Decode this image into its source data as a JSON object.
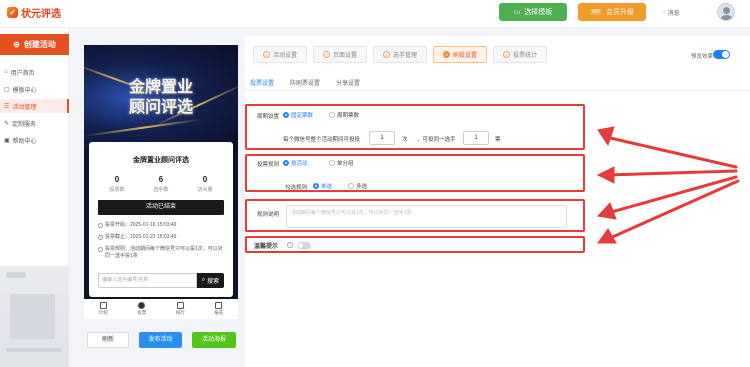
{
  "header": {
    "logo_text": "状元评选",
    "template_button": "选择模板",
    "vip_badge": "VIP",
    "vip_button": "会员升级",
    "message": "消息"
  },
  "sidebar": {
    "create_button": "创建活动",
    "items": [
      {
        "label": "用户首页",
        "icon": "home-icon"
      },
      {
        "label": "模板中心",
        "icon": "template-icon"
      },
      {
        "label": "活动管理",
        "icon": "list-icon",
        "active": true
      },
      {
        "label": "定制服务",
        "icon": "edit-icon"
      },
      {
        "label": "帮助中心",
        "icon": "help-icon"
      }
    ]
  },
  "preview": {
    "hero_line1": "金牌置业",
    "hero_line2": "顾问评选",
    "card_title": "金牌置业顾问评选",
    "stats": [
      {
        "value": "0",
        "label": "投票数"
      },
      {
        "value": "6",
        "label": "选手数"
      },
      {
        "value": "0",
        "label": "访问量"
      }
    ],
    "ended_label": "活动已结束",
    "info": [
      "投票开始：2025-01-16 15:03:49",
      "投票截止：2025-01-23 15:03:49",
      "投票规则：活动期间每个微信号只可以投1次，可以对同一选手投1票"
    ],
    "search_placeholder": "编输入选手编号/名称",
    "search_button": "搜索",
    "tabs": [
      {
        "label": "介绍",
        "icon": "intro-icon"
      },
      {
        "label": "投票",
        "icon": "vote-icon"
      },
      {
        "label": "排行",
        "icon": "rank-icon"
      },
      {
        "label": "报名",
        "icon": "signup-icon"
      }
    ],
    "refresh_button": "刷新",
    "publish_button": "发布活动",
    "poster_button": "活动海报"
  },
  "settings": {
    "steps": [
      {
        "num": "1",
        "label": "活动设置"
      },
      {
        "num": "2",
        "label": "页面设置"
      },
      {
        "num": "3",
        "label": "选手管理"
      },
      {
        "num": "4",
        "label": "刷投设置",
        "active": true
      },
      {
        "num": "5",
        "label": "投票统计"
      }
    ],
    "preview_switch_label": "预览效果",
    "subtabs": [
      "投票设置",
      "防刷票设置",
      "分享设置"
    ],
    "period_label": "周期设置",
    "period_options": [
      "固定票数",
      "周期票数"
    ],
    "votes_prefix": "每个微信号整个活动期间可投投",
    "votes_count": "1",
    "votes_unit": "次",
    "votes_mid": "，可投同一选手",
    "votes_same": "1",
    "votes_suffix": "票",
    "rule_label": "投票规则",
    "rule_options": [
      "投活动",
      "单分组"
    ],
    "check_label": "勾选规则",
    "check_options": [
      "单选",
      "多选"
    ],
    "desc_label": "规则说明",
    "desc_placeholder": "活动期间每个微信号只可以投1次，可以对同一选手1票",
    "tip_label": "温馨提示",
    "tip_icon": "?"
  },
  "colors": {
    "accent": "#e5501f",
    "highlight_box": "#e53b3b",
    "primary_blue": "#1e80ff"
  }
}
